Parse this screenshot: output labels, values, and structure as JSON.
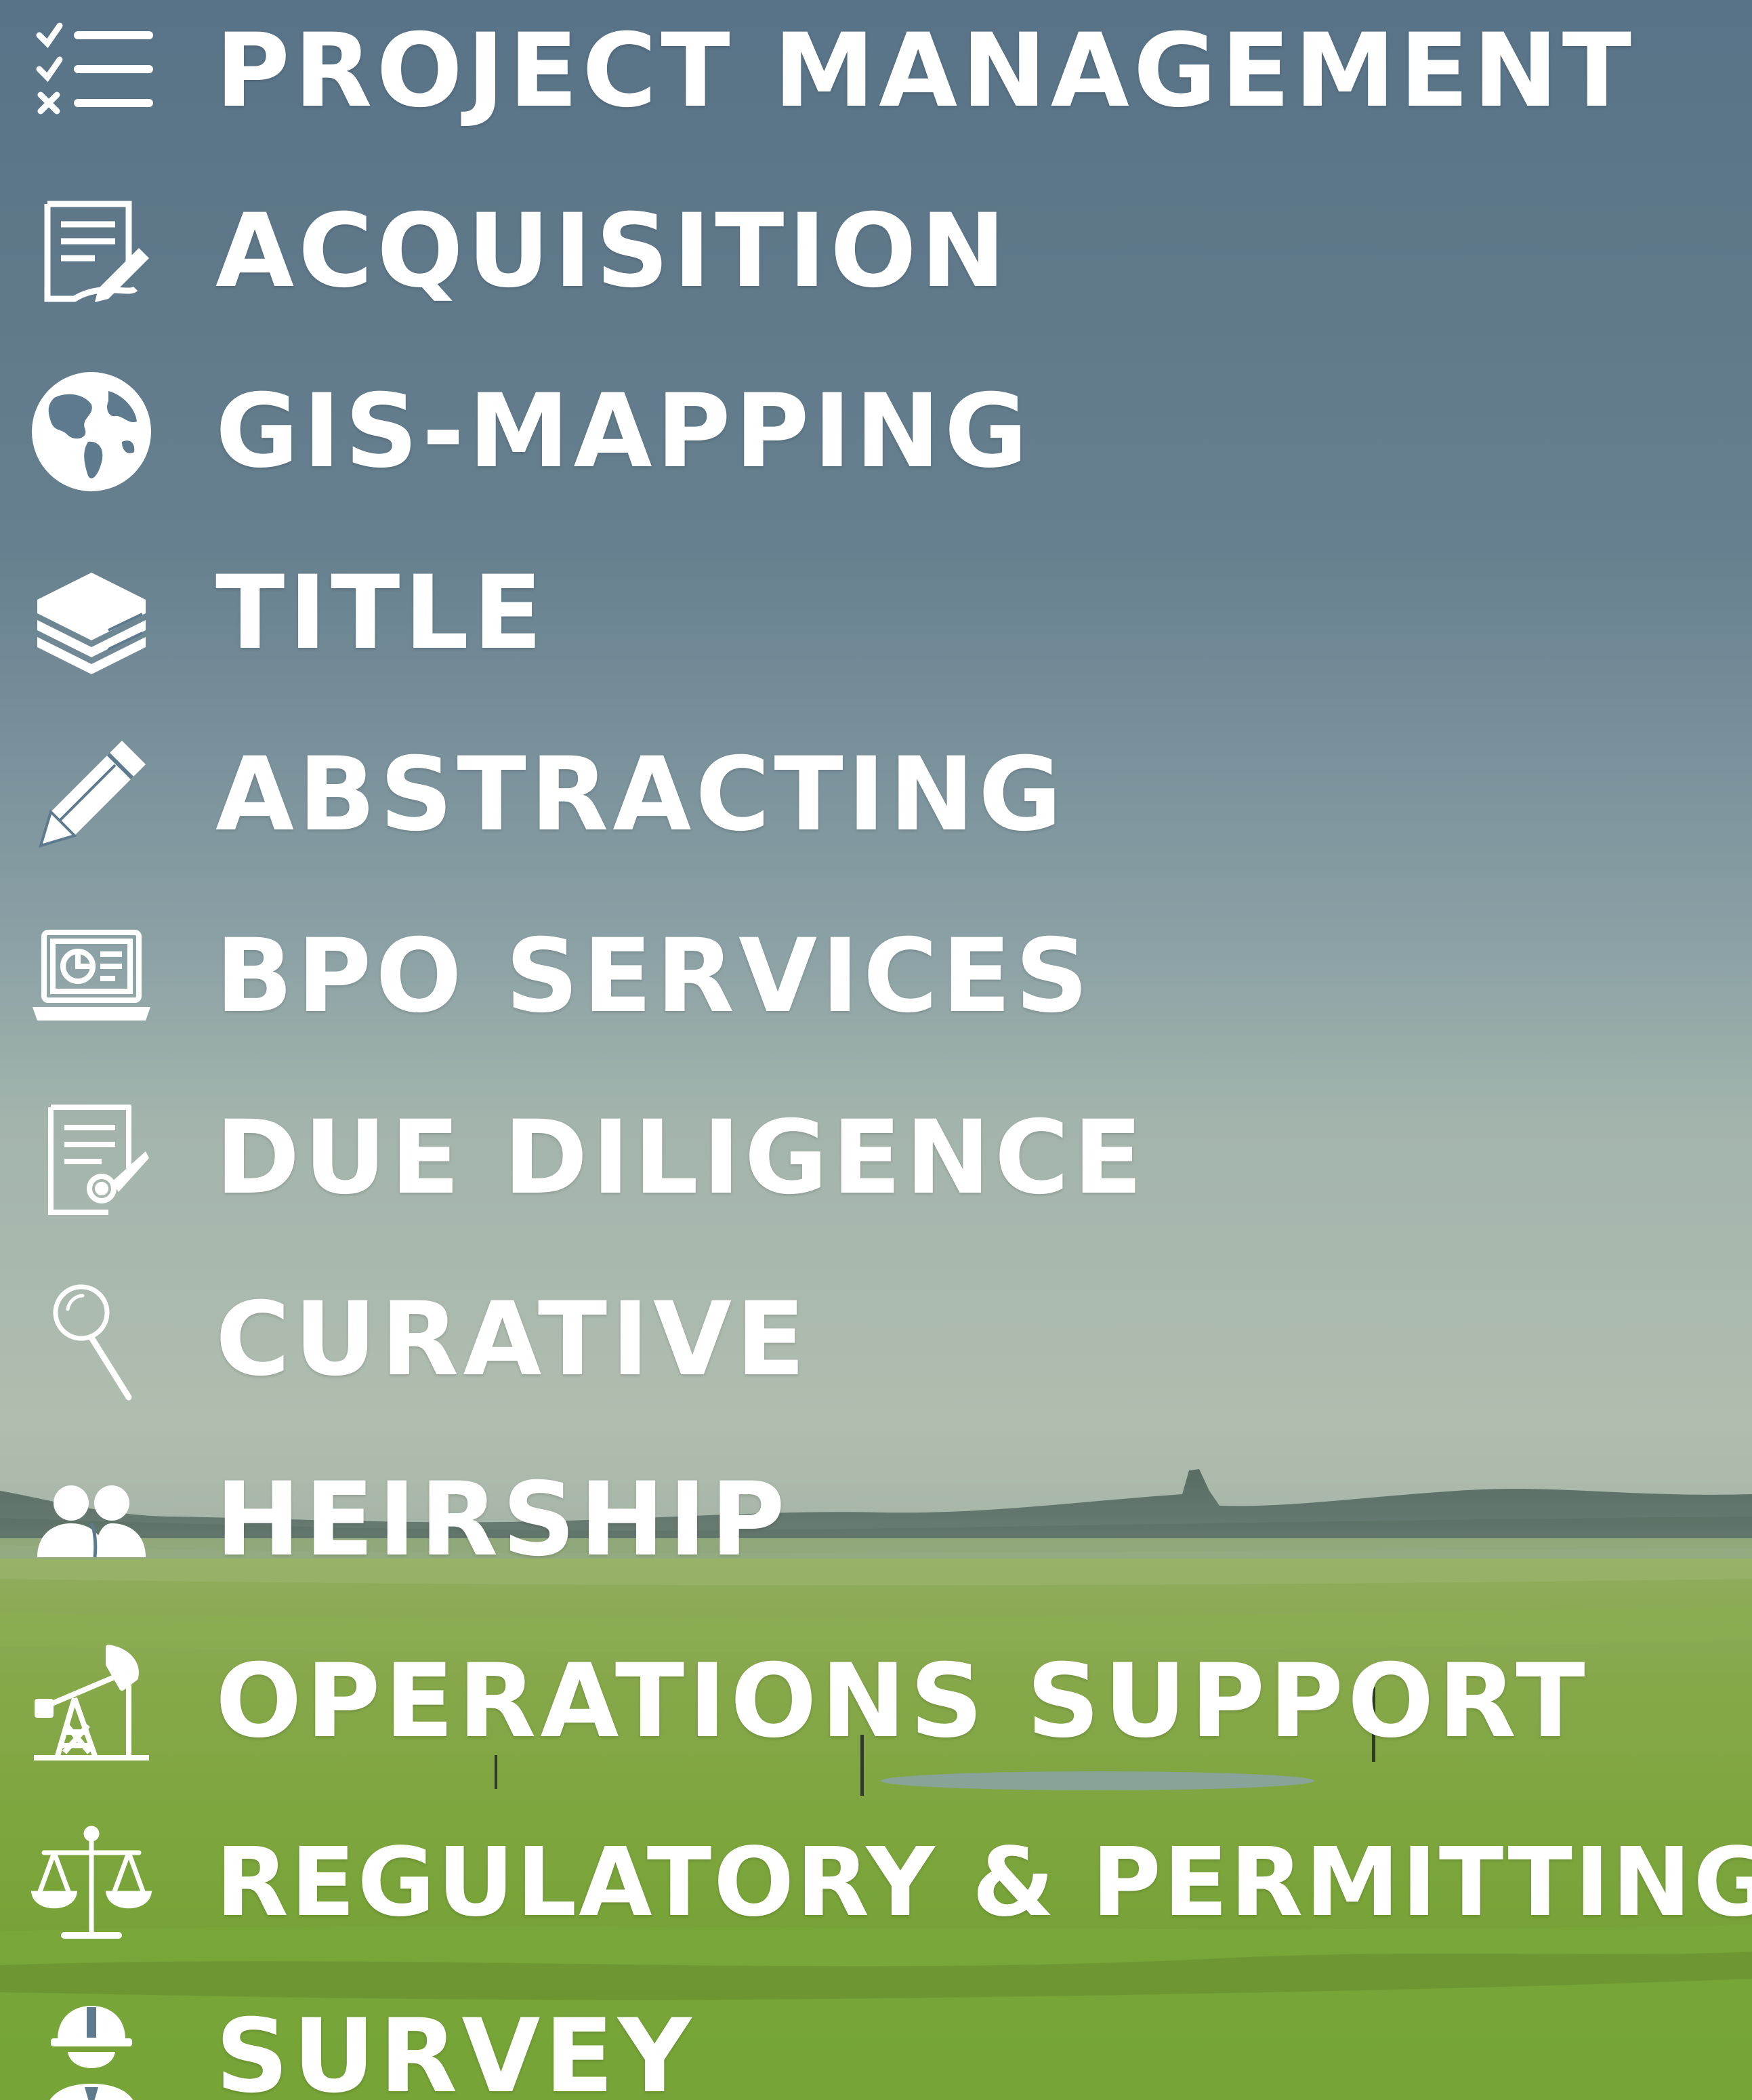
{
  "colors": {
    "sky_top": "#5b7589",
    "sky_mid": "#7c95a0",
    "sky_horizon": "#a8b8b0",
    "field_far": "#8fab55",
    "field_near": "#7da63a",
    "text": "#ffffff"
  },
  "services": [
    {
      "icon": "checklist-icon",
      "label": "PROJECT MANAGEMENT"
    },
    {
      "icon": "document-edit-icon",
      "label": "ACQUISITION"
    },
    {
      "icon": "globe-icon",
      "label": "GIS-MAPPING"
    },
    {
      "icon": "books-icon",
      "label": "TITLE"
    },
    {
      "icon": "pencil-icon",
      "label": "ABSTRACTING"
    },
    {
      "icon": "laptop-chart-icon",
      "label": "BPO SERVICES"
    },
    {
      "icon": "certificate-icon",
      "label": "DUE DILIGENCE"
    },
    {
      "icon": "magnifier-icon",
      "label": "CURATIVE"
    },
    {
      "icon": "people-icon",
      "label": "HEIRSHIP"
    },
    {
      "icon": "oil-pump-icon",
      "label": "OPERATIONS SUPPORT"
    },
    {
      "icon": "scales-icon",
      "label": "REGULATORY & PERMITTING"
    },
    {
      "icon": "surveyor-icon",
      "label": "SURVEY"
    }
  ]
}
